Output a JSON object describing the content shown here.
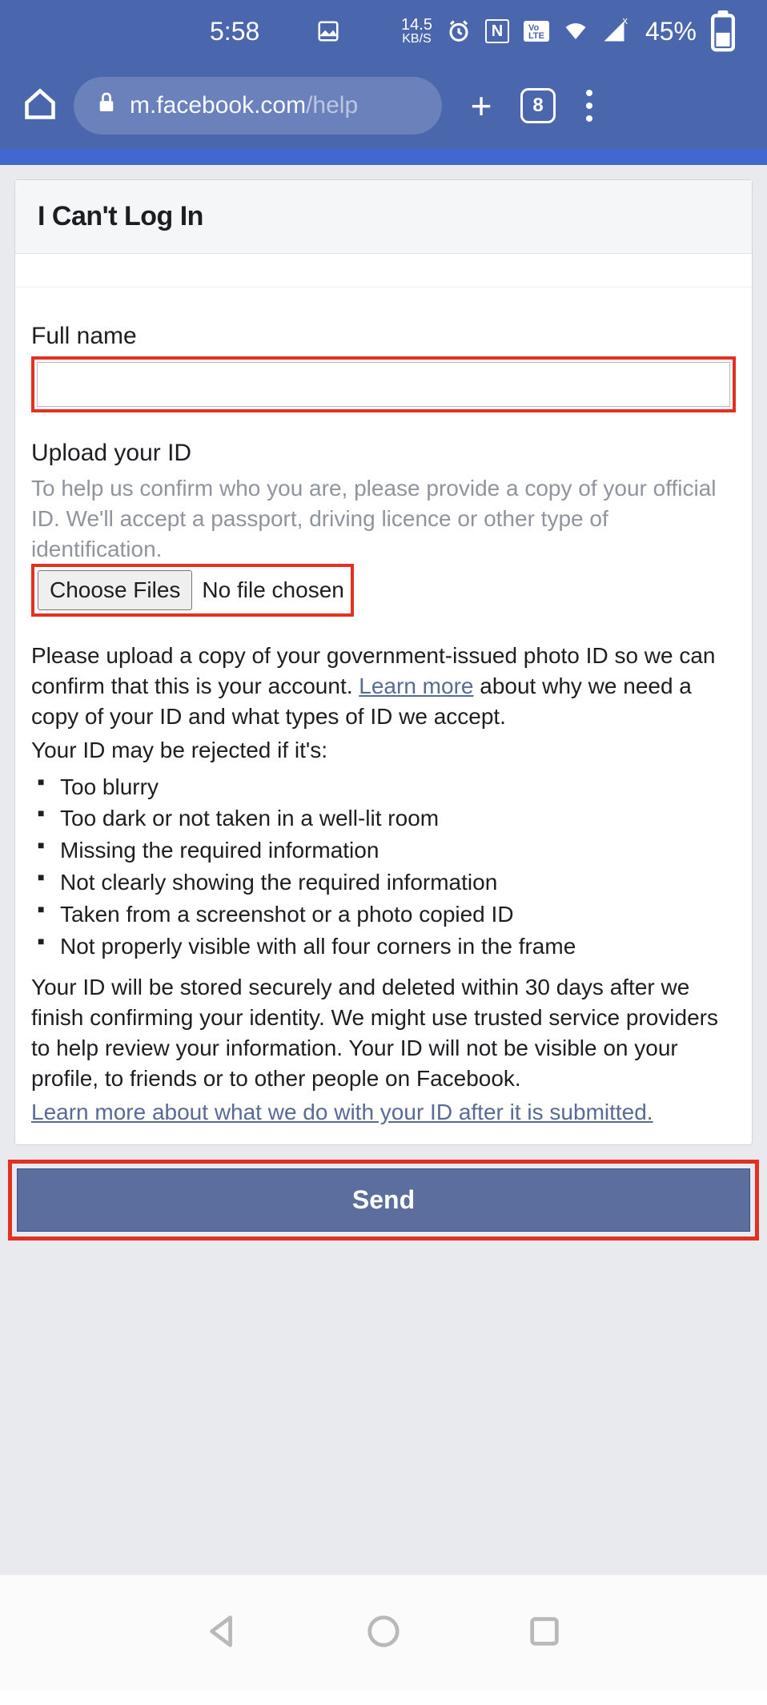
{
  "status": {
    "time": "5:58",
    "kbs_rate": "14.5",
    "kbs_label": "KB/S",
    "volte": "Vo\nLTE",
    "battery_pct": "45%"
  },
  "browser": {
    "url_domain": "m.facebook.com",
    "url_path": "/help",
    "tab_count": "8"
  },
  "page": {
    "title": "I Can't Log In",
    "full_name_label": "Full name",
    "full_name_value": "",
    "upload_label": "Upload your ID",
    "upload_help": "To help us confirm who you are, please provide a copy of your official ID. We'll accept a passport, driving licence or other type of identification.",
    "choose_files_label": "Choose Files",
    "no_file_label": "No file chosen",
    "para1_pre": "Please upload a copy of your government-issued photo ID so we can confirm that this is your account. ",
    "learn_more_label": "Learn more",
    "para1_post": " about why we need a copy of your ID and what types of ID we accept.",
    "rejected_heading": "Your ID may be rejected if it's:",
    "rejected_list": [
      "Too blurry",
      "Too dark or not taken in a well-lit room",
      "Missing the required information",
      "Not clearly showing the required information",
      "Taken from a screenshot or a photo copied ID",
      "Not properly visible with all four corners in the frame"
    ],
    "storage_para": "Your ID will be stored securely and deleted within 30 days after we finish confirming your identity. We might use trusted service providers to help review your information. Your ID will not be visible on your profile, to friends or to other people on Facebook.",
    "learn_more_link2": "Learn more about what we do with your ID after it is submitted.",
    "send_label": "Send"
  }
}
